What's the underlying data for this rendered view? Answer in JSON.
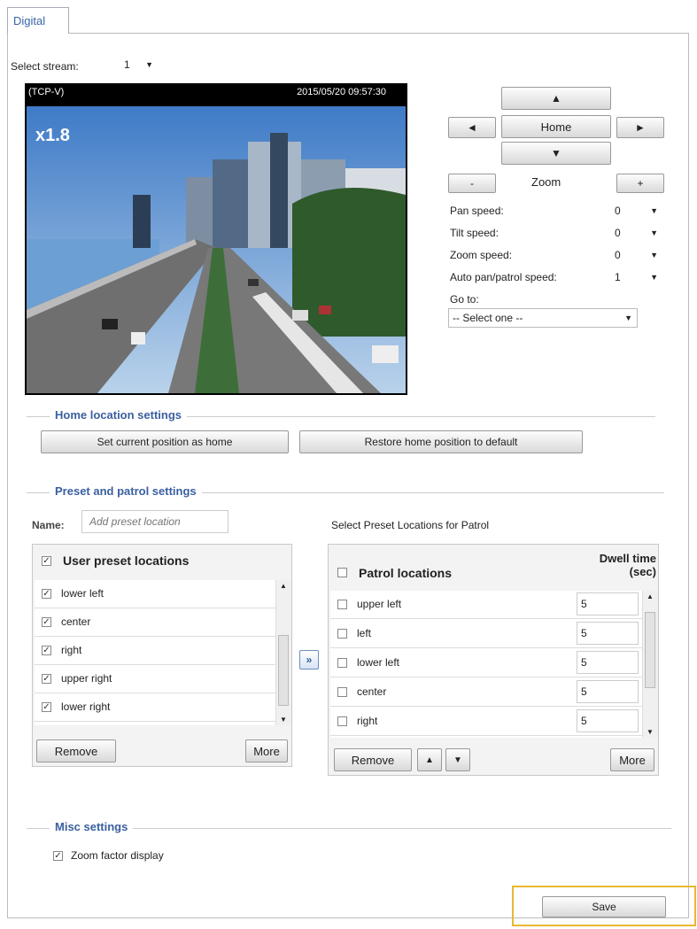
{
  "tab": {
    "label": "Digital"
  },
  "stream": {
    "label": "Select stream:",
    "value": "1"
  },
  "video": {
    "protocol": "(TCP-V)",
    "timestamp": "2015/05/20 09:57:30",
    "zoom_factor": "x1.8"
  },
  "ptz": {
    "up": "▲",
    "down": "▼",
    "left": "◄",
    "right": "►",
    "home": "Home",
    "zoom_minus": "-",
    "zoom_label": "Zoom",
    "zoom_plus": "+"
  },
  "speeds": [
    {
      "label": "Pan speed:",
      "value": "0"
    },
    {
      "label": "Tilt speed:",
      "value": "0"
    },
    {
      "label": "Zoom speed:",
      "value": "0"
    },
    {
      "label": "Auto pan/patrol speed:",
      "value": "1"
    }
  ],
  "goto": {
    "label": "Go to:",
    "value": "-- Select one --"
  },
  "home_settings": {
    "title": "Home location settings",
    "set_button": "Set current position as home",
    "restore_button": "Restore home position to default"
  },
  "preset": {
    "title": "Preset and patrol settings",
    "name_label": "Name:",
    "name_placeholder": "Add preset location",
    "select_label": "Select Preset Locations for Patrol",
    "user_header": "User preset locations",
    "user_items": [
      "lower left",
      "center",
      "right",
      "upper right",
      "lower right"
    ],
    "move_button": "»",
    "remove": "Remove",
    "more": "More",
    "patrol_header": "Patrol locations",
    "dwell_header_1": "Dwell time",
    "dwell_header_2": "(sec)",
    "patrol_items": [
      {
        "name": "upper left",
        "dwell": "5"
      },
      {
        "name": "left",
        "dwell": "5"
      },
      {
        "name": "lower left",
        "dwell": "5"
      },
      {
        "name": "center",
        "dwell": "5"
      },
      {
        "name": "right",
        "dwell": "5"
      }
    ],
    "patrol_remove": "Remove",
    "patrol_up": "▲",
    "patrol_down": "▼",
    "patrol_more": "More"
  },
  "misc": {
    "title": "Misc settings",
    "zoom_display": "Zoom factor display"
  },
  "save": "Save",
  "colors": {
    "section_title": "#3a5f9f",
    "highlight": "#e8b830"
  }
}
